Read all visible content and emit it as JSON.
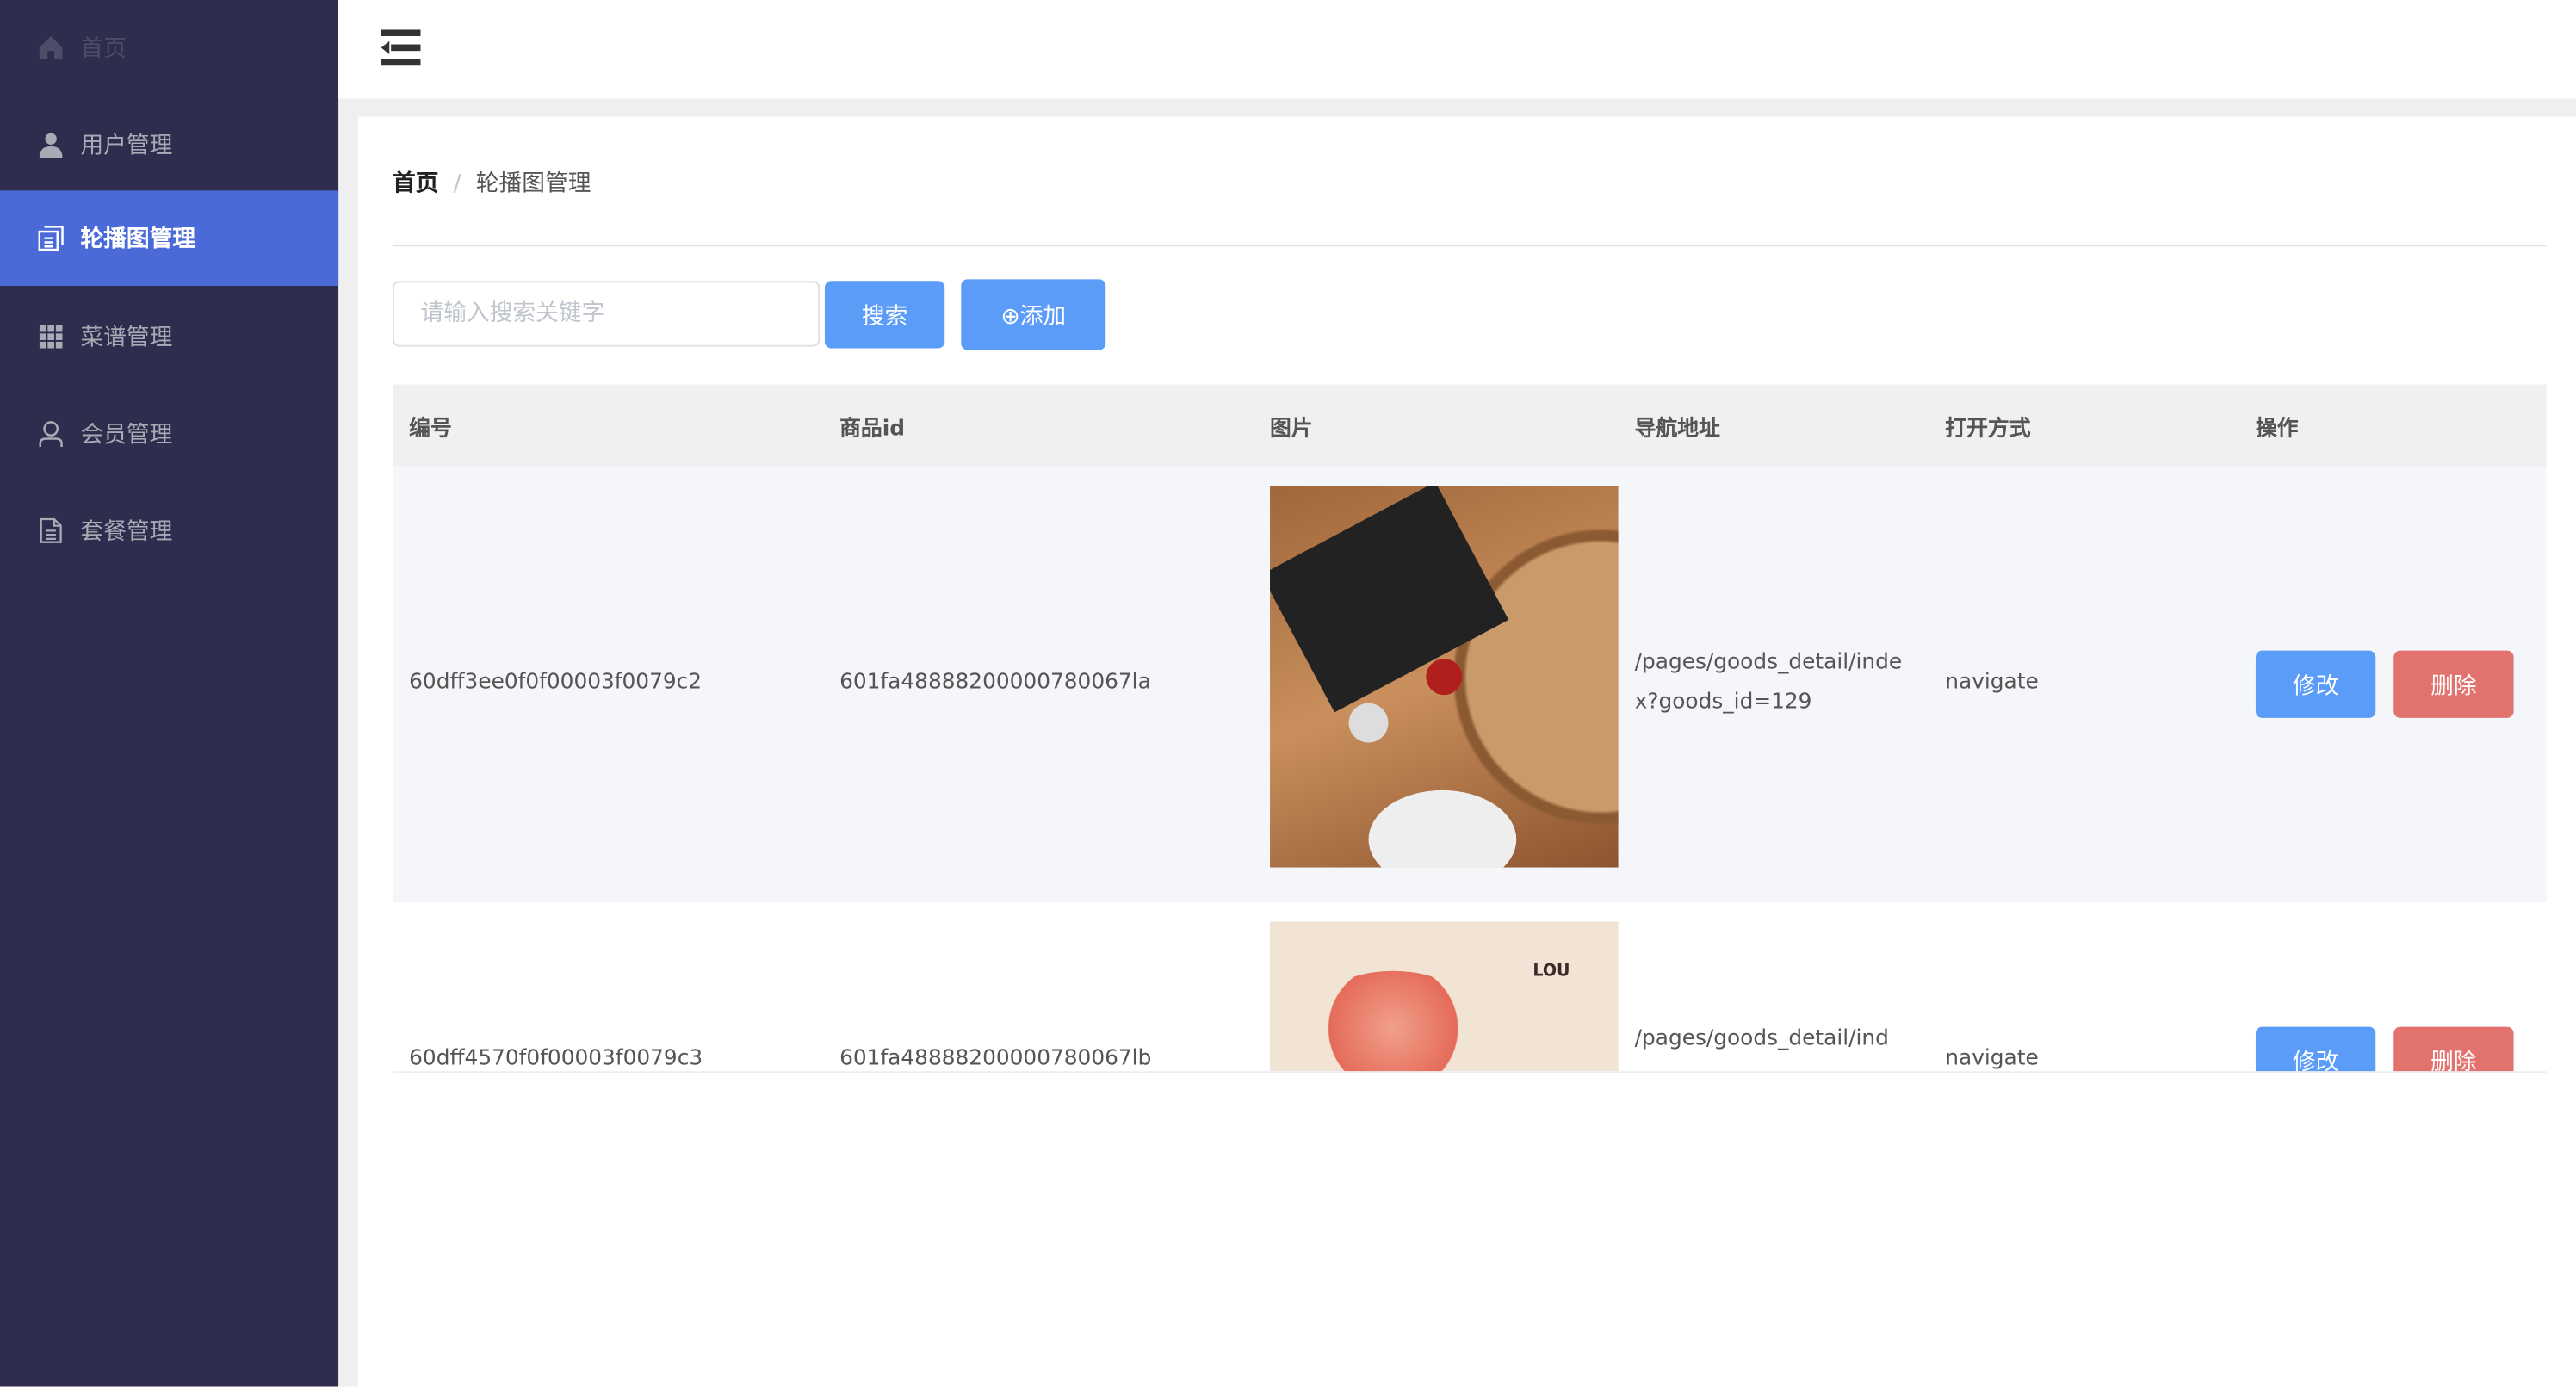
{
  "sidebar": {
    "items": [
      {
        "label": "首页",
        "icon": "home-icon"
      },
      {
        "label": "用户管理",
        "icon": "user-icon"
      },
      {
        "label": "轮播图管理",
        "icon": "document-icon",
        "active": true
      },
      {
        "label": "菜谱管理",
        "icon": "grid-icon"
      },
      {
        "label": "会员管理",
        "icon": "person-outline-icon"
      },
      {
        "label": "套餐管理",
        "icon": "file-icon"
      }
    ],
    "active_color": "#4a6ad8",
    "bg_color": "#2e2d4d"
  },
  "breadcrumb": {
    "home": "首页",
    "separator": "/",
    "current": "轮播图管理"
  },
  "toolbar": {
    "search_placeholder": "请输入搜索关键字",
    "search_label": "搜索",
    "add_label": "⊕添加"
  },
  "table": {
    "headers": [
      "编号",
      "商品id",
      "图片",
      "导航地址",
      "打开方式",
      "操作"
    ],
    "rows": [
      {
        "id": "60dff3ee0f0f00003f0079c2",
        "goods_id": "601fa48888200000780067la",
        "url": "/pages/goods_detail/index?goods_id=129",
        "open_type": "navigate",
        "edit": "修改",
        "delete": "删除"
      },
      {
        "id": "60dff4570f0f00003f0079c3",
        "goods_id": "601fa48888200000780067lb",
        "url": "/pages/goods_detail/ind",
        "open_type": "navigate",
        "edit": "修改",
        "delete": "删除"
      }
    ]
  },
  "colors": {
    "primary": "#5a9cf8",
    "danger": "#e2726e"
  }
}
